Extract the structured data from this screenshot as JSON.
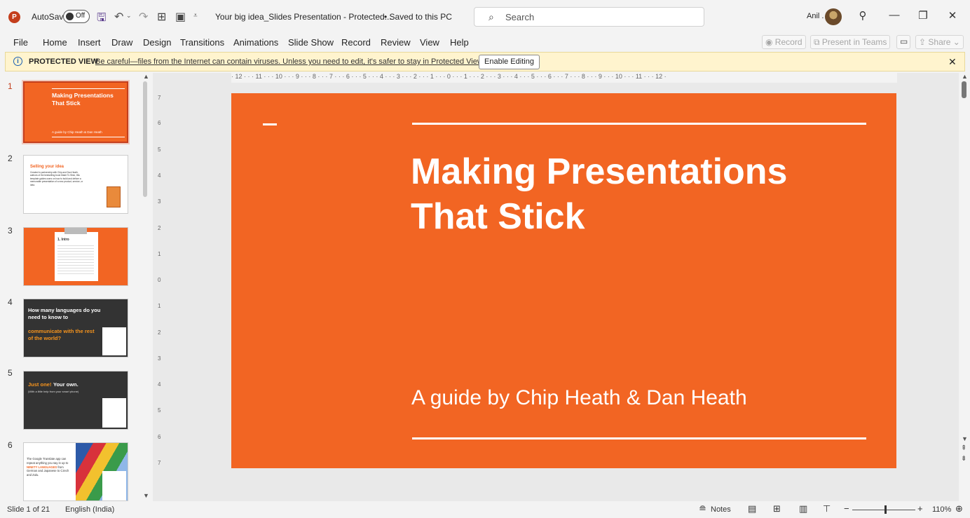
{
  "titlebar": {
    "app_icon": "powerpoint-icon",
    "autosave_label": "AutoSave",
    "autosave_state": "Off",
    "doc_title": "Your big idea_Slides Presentation  -  Protected...",
    "save_status": "• Saved to this PC",
    "search_placeholder": "Search",
    "user_name": "Anil ."
  },
  "menu": [
    "File",
    "Home",
    "Insert",
    "Draw",
    "Design",
    "Transitions",
    "Animations",
    "Slide Show",
    "Record",
    "Review",
    "View",
    "Help"
  ],
  "ribbon_right": {
    "record": "◉ Record",
    "present": "⧉ Present in Teams",
    "share": "⇪ Share ⌄"
  },
  "protected_view": {
    "title": "PROTECTED VIEW",
    "message": "Be careful—files from the Internet can contain viruses. Unless you need to edit, it's safer to stay in Protected View.",
    "button": "Enable Editing"
  },
  "thumbnails": [
    {
      "num": "1",
      "title": "Making Presentations That Stick",
      "sub": "A guide by Chip Heath & Dan Heath"
    },
    {
      "num": "2",
      "title": "Selling your idea",
      "body": "Created in partnership with Chip and Dan Heath, authors of the bestselling book Made To Stick, this template guides users on how to build and deliver a memorable presentation of a new product, service, or idea."
    },
    {
      "num": "3",
      "title": "1. Intro"
    },
    {
      "num": "4",
      "title_a": "How many languages do you need to know to",
      "title_b": "communicate with the rest of the world?"
    },
    {
      "num": "5",
      "title_a": "Just one!",
      "title_b": "Your own.",
      "sub": "(With a little help from your smart phone)"
    },
    {
      "num": "6",
      "body_a": "The Google Translate app can repeat anything you say in up to",
      "body_b": "NINETY LANGUAGES",
      "body_c": "from German and Japanese to Czech and Zulu."
    }
  ],
  "ruler_h": "· 12 · · · 11 · · · 10 · · · 9 · · · 8 · · · 7 · · · 6 · · · 5 · · · 4 · · · 3 · · · 2 · · · 1 · · · 0 · · · 1 · · · 2 · · · 3 · · · 4 · · · 5 · · · 6 · · · 7 · · · 8 · · · 9 · · · 10 · · · 11 · · · 12 ·",
  "ruler_v": [
    "7",
    "6",
    "5",
    "4",
    "3",
    "2",
    "1",
    "0",
    "1",
    "2",
    "3",
    "4",
    "5",
    "6",
    "7"
  ],
  "slide": {
    "title": "Making Presentations That Stick",
    "subtitle": "A guide by Chip Heath & Dan Heath",
    "background": "#f26523"
  },
  "status": {
    "slide_of": "Slide 1 of 21",
    "language": "English (India)",
    "notes": "Notes",
    "zoom": "110%"
  }
}
